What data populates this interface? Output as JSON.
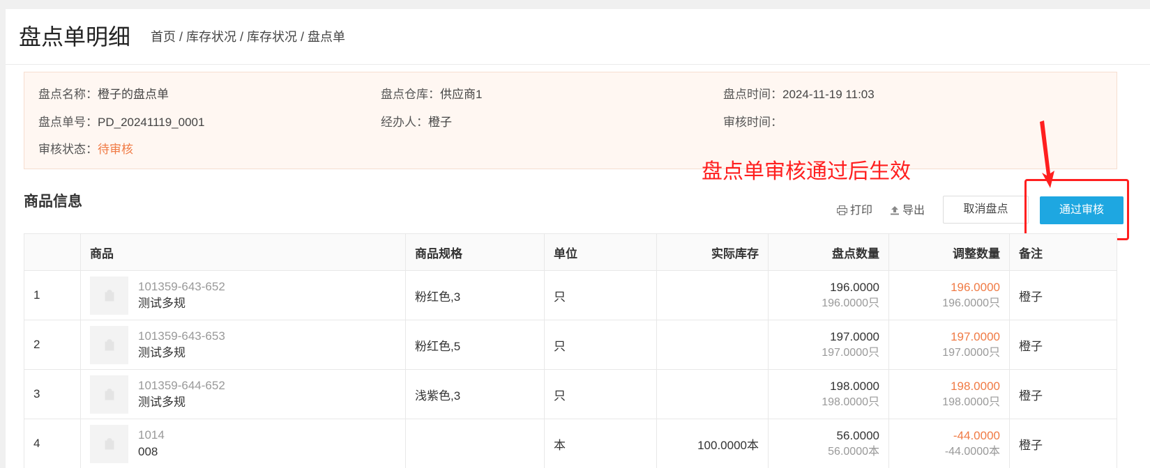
{
  "header": {
    "title": "盘点单明细",
    "breadcrumb": "首页 / 库存状况 / 库存状况 / 盘点单"
  },
  "info": {
    "name_label": "盘点名称：",
    "name_value": "橙子的盘点单",
    "warehouse_label": "盘点仓库：",
    "warehouse_value": "供应商1",
    "time_label": "盘点时间：",
    "time_value": "2024-11-19 11:03",
    "number_label": "盘点单号：",
    "number_value": "PD_20241119_0001",
    "handler_label": "经办人：",
    "handler_value": "橙子",
    "audit_time_label": "审核时间：",
    "audit_time_value": "",
    "status_label": "审核状态：",
    "status_value": "待审核"
  },
  "annotation": "盘点单审核通过后生效",
  "section": {
    "title": "商品信息",
    "print_label": "打印",
    "export_label": "导出",
    "cancel_label": "取消盘点",
    "approve_label": "通过审核"
  },
  "table": {
    "headers": [
      "",
      "商品",
      "商品规格",
      "单位",
      "实际库存",
      "盘点数量",
      "调整数量",
      "备注"
    ],
    "rows": [
      {
        "idx": "1",
        "code": "101359-643-652",
        "name": "测试多规",
        "spec": "粉红色,3",
        "unit": "只",
        "stock": "",
        "count_main": "196.0000",
        "count_sub": "196.0000只",
        "adj_main": "196.0000",
        "adj_sub": "196.0000只",
        "note": "橙子"
      },
      {
        "idx": "2",
        "code": "101359-643-653",
        "name": "测试多规",
        "spec": "粉红色,5",
        "unit": "只",
        "stock": "",
        "count_main": "197.0000",
        "count_sub": "197.0000只",
        "adj_main": "197.0000",
        "adj_sub": "197.0000只",
        "note": "橙子"
      },
      {
        "idx": "3",
        "code": "101359-644-652",
        "name": "测试多规",
        "spec": "浅紫色,3",
        "unit": "只",
        "stock": "",
        "count_main": "198.0000",
        "count_sub": "198.0000只",
        "adj_main": "198.0000",
        "adj_sub": "198.0000只",
        "note": "橙子"
      },
      {
        "idx": "4",
        "code": "1014",
        "name": "008",
        "spec": "",
        "unit": "本",
        "stock": "100.0000本",
        "count_main": "56.0000",
        "count_sub": "56.0000本",
        "adj_main": "-44.0000",
        "adj_sub": "-44.0000本",
        "note": "橙子"
      }
    ]
  },
  "colors": {
    "accent": "#1ea7e1",
    "pending": "#f07a44",
    "annotation": "#ff1f1f",
    "info_bg": "#fff7f2"
  },
  "icons": {
    "print": "printer-icon",
    "export": "upload-icon",
    "thumb": "bag-icon"
  }
}
